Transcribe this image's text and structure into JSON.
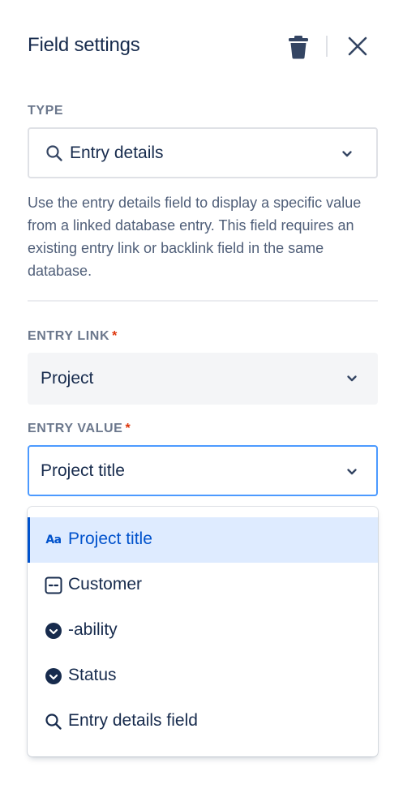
{
  "header": {
    "title": "Field settings"
  },
  "type_field": {
    "label": "TYPE",
    "value": "Entry details"
  },
  "description": "Use the entry details field to display a specific value from a linked database entry. This field requires an existing entry link or backlink field in the same database.",
  "entry_link": {
    "label": "ENTRY LINK",
    "required_mark": "*",
    "value": "Project"
  },
  "entry_value": {
    "label": "ENTRY VALUE",
    "required_mark": "*",
    "value": "Project title"
  },
  "menu": {
    "items": [
      {
        "label": "Project title",
        "icon": "text-aa-icon",
        "selected": true
      },
      {
        "label": "Customer",
        "icon": "field-dashed-box-icon",
        "selected": false
      },
      {
        "label": "-ability",
        "icon": "check-circle-icon",
        "selected": false
      },
      {
        "label": "Status",
        "icon": "check-circle-icon",
        "selected": false
      },
      {
        "label": "Entry details field",
        "icon": "search-icon",
        "selected": false
      }
    ]
  },
  "colors": {
    "accent": "#0052cc",
    "focus_border": "#4c9aff",
    "selected_bg": "#deebff",
    "required": "#de350b"
  }
}
